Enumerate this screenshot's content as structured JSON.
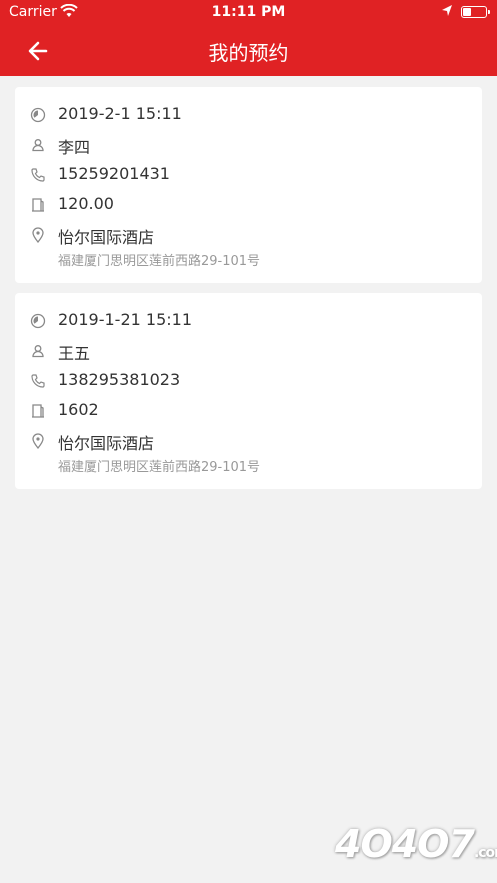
{
  "status_bar": {
    "carrier": "Carrier",
    "time": "11:11 PM"
  },
  "header": {
    "title": "我的预约",
    "accent": "#e02224"
  },
  "appointments": [
    {
      "datetime": "2019-2-1 15:11",
      "name": "李四",
      "phone": "15259201431",
      "room": "120.00",
      "hotel": "怡尔国际酒店",
      "address": "福建厦门思明区莲前西路29-101号"
    },
    {
      "datetime": "2019-1-21 15:11",
      "name": "王五",
      "phone": "138295381023",
      "room": "1602",
      "hotel": "怡尔国际酒店",
      "address": "福建厦门思明区莲前西路29-101号"
    }
  ],
  "icons": {
    "time": "clock-icon",
    "person": "person-icon",
    "phone": "phone-icon",
    "room": "door-icon",
    "location": "location-pin-icon"
  },
  "watermark": {
    "main": "4O4O7",
    "suffix": ".com"
  }
}
